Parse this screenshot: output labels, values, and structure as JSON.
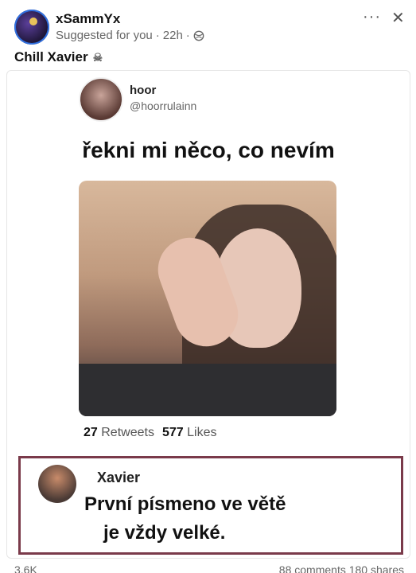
{
  "post": {
    "author": "xSammYx",
    "suggested": "Suggested for you",
    "time": "22h",
    "caption": "Chill Xavier",
    "caption_icon": "skull-icon"
  },
  "tweet": {
    "name": "hoor",
    "handle": "@hoorrulainn",
    "text": "řekni mi něco, co nevím",
    "retweets_count": "27",
    "retweets_label": "Retweets",
    "likes_count": "577",
    "likes_label": "Likes"
  },
  "reply": {
    "name": "Xavier",
    "line1": "První písmeno ve větě",
    "line2": "je vždy  velké."
  },
  "engagement": {
    "reactions": "3.6K",
    "comments_shares": "88 comments  180 shares"
  }
}
